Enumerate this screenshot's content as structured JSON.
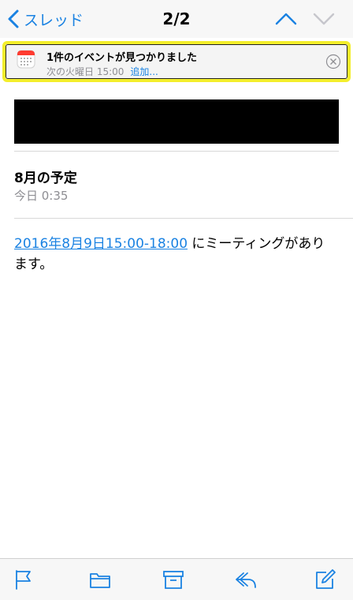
{
  "nav": {
    "back_label": "スレッド",
    "title": "2/2"
  },
  "event_banner": {
    "title": "1件のイベントが見つかりました",
    "time": "次の火曜日 15:00",
    "add_label": "追加..."
  },
  "message": {
    "subject": "8月の予定",
    "date": "今日 0:35",
    "body_link": "2016年8月9日15:00-18:00",
    "body_text": " にミーティングがあります。"
  },
  "toolbar": {
    "icons": [
      "flag-icon",
      "folder-icon",
      "archive-icon",
      "reply-icon",
      "compose-icon"
    ]
  },
  "colors": {
    "accent": "#1a82e2",
    "highlight": "#f3ee2b",
    "secondary_text": "#8e8e93"
  }
}
